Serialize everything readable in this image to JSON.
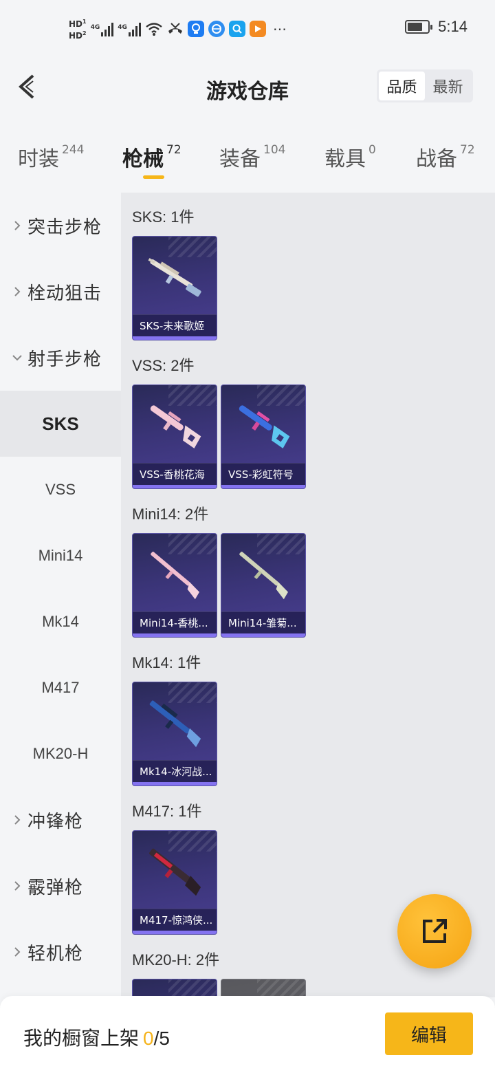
{
  "status_bar": {
    "hd1": "HD",
    "hd1_sub": "1",
    "hd2": "HD",
    "hd2_sub": "2",
    "network1": "4G",
    "network2": "4G",
    "battery_level": 0.75,
    "time": "5:14",
    "icons": [
      "wifi-icon",
      "missed-call-icon",
      "bulb-app-icon",
      "browser-app-icon",
      "search-app-icon",
      "video-app-icon",
      "more-icon"
    ]
  },
  "header": {
    "title": "游戏仓库",
    "sort_options": [
      "品质",
      "最新"
    ],
    "sort_selected": "品质"
  },
  "tabs": [
    {
      "label": "时装",
      "count": "244"
    },
    {
      "label": "枪械",
      "count": "72",
      "active": true
    },
    {
      "label": "装备",
      "count": "104"
    },
    {
      "label": "载具",
      "count": "0"
    },
    {
      "label": "战备",
      "count": "72"
    }
  ],
  "sidebar": {
    "items": [
      {
        "label": "突击步枪",
        "type": "category",
        "expanded": false
      },
      {
        "label": "栓动狙击",
        "type": "category",
        "expanded": false
      },
      {
        "label": "射手步枪",
        "type": "category",
        "expanded": true
      },
      {
        "label": "SKS",
        "type": "sub",
        "active": true
      },
      {
        "label": "VSS",
        "type": "sub"
      },
      {
        "label": "Mini14",
        "type": "sub"
      },
      {
        "label": "Mk14",
        "type": "sub"
      },
      {
        "label": "M417",
        "type": "sub"
      },
      {
        "label": "MK20-H",
        "type": "sub"
      },
      {
        "label": "冲锋枪",
        "type": "category",
        "expanded": false
      },
      {
        "label": "霰弹枪",
        "type": "category",
        "expanded": false
      },
      {
        "label": "轻机枪",
        "type": "category",
        "expanded": false
      }
    ]
  },
  "groups": [
    {
      "title": "SKS: 1件",
      "items": [
        "SKS-未来歌姬"
      ]
    },
    {
      "title": "VSS: 2件",
      "items": [
        "VSS-香桃花海",
        "VSS-彩虹符号"
      ]
    },
    {
      "title": "Mini14: 2件",
      "items": [
        "Mini14-香桃...",
        "Mini14-雏菊..."
      ]
    },
    {
      "title": "Mk14: 1件",
      "items": [
        "Mk14-冰河战..."
      ]
    },
    {
      "title": "M417: 1件",
      "items": [
        "M417-惊鸿侠..."
      ]
    },
    {
      "title": "MK20-H: 2件",
      "items": [
        "",
        ""
      ]
    }
  ],
  "bottom_bar": {
    "showcase_label": "我的橱窗上架",
    "showcase_current": "0",
    "showcase_separator": "/",
    "showcase_max": "5",
    "edit_label": "编辑"
  },
  "colors": {
    "accent": "#f6b619",
    "card_bg": "#3a3477",
    "card_border": "#8473f0",
    "page_bg": "#f4f5f7",
    "content_bg": "#e8e9ec"
  }
}
